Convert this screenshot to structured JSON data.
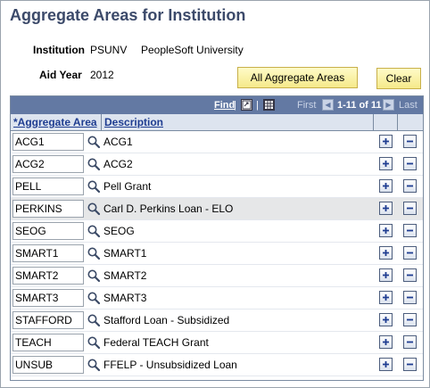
{
  "page_title": "Aggregate Areas for Institution",
  "institution": {
    "label": "Institution",
    "code": "PSUNV",
    "name": "PeopleSoft University"
  },
  "aid_year": {
    "label": "Aid Year",
    "value": "2012"
  },
  "buttons": {
    "all_areas": "All Aggregate Areas",
    "clear": "Clear"
  },
  "grid": {
    "nav": {
      "find": "Find",
      "first": "First",
      "range": "1-11 of 11",
      "last": "Last"
    },
    "headers": {
      "area": "*Aggregate Area",
      "description": "Description"
    },
    "rows": [
      {
        "code": "ACG1",
        "description": "ACG1"
      },
      {
        "code": "ACG2",
        "description": "ACG2"
      },
      {
        "code": "PELL",
        "description": "Pell Grant"
      },
      {
        "code": "PERKINS",
        "description": "Carl D. Perkins Loan - ELO"
      },
      {
        "code": "SEOG",
        "description": "SEOG"
      },
      {
        "code": "SMART1",
        "description": "SMART1"
      },
      {
        "code": "SMART2",
        "description": "SMART2"
      },
      {
        "code": "SMART3",
        "description": "SMART3"
      },
      {
        "code": "STAFFORD",
        "description": "Stafford Loan - Subsidized"
      },
      {
        "code": "TEACH",
        "description": "Federal TEACH Grant"
      },
      {
        "code": "UNSUB",
        "description": "FFELP -  Unsubsidized Loan"
      }
    ],
    "highlighted_row": 3
  },
  "icons": {
    "lookup": "magnifier-icon",
    "add": "plus-icon",
    "delete": "minus-icon",
    "view_all": "view-all-icon",
    "download": "spreadsheet-icon"
  },
  "colors": {
    "title": "#3c4a6a",
    "grid_nav": "#6379a3",
    "header_link": "#1f3d91",
    "button": "#f5e98a"
  }
}
